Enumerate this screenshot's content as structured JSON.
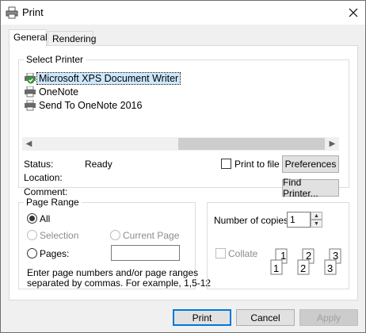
{
  "window": {
    "title": "Print",
    "close_symbol": "✕"
  },
  "tabs": [
    {
      "label": "General",
      "active": true
    },
    {
      "label": "Rendering",
      "active": false
    }
  ],
  "select_printer": {
    "group_label": "Select Printer",
    "printers": [
      {
        "name": "Microsoft XPS Document Writer",
        "selected": true,
        "icon": "printer-default-icon"
      },
      {
        "name": "OneNote",
        "selected": false,
        "icon": "printer-icon"
      },
      {
        "name": "Send To OneNote 2016",
        "selected": false,
        "icon": "printer-icon"
      }
    ],
    "status_label": "Status:",
    "status_value": "Ready",
    "location_label": "Location:",
    "comment_label": "Comment:",
    "print_to_file_label": "Print to file",
    "preferences_label": "Preferences",
    "find_printer_label": "Find Printer..."
  },
  "page_range": {
    "group_label": "Page Range",
    "all_label": "All",
    "selection_label": "Selection",
    "current_page_label": "Current Page",
    "pages_label": "Pages:",
    "pages_value": "",
    "help_line1": "Enter page numbers and/or page ranges",
    "help_line2": "separated by commas.  For example, 1,5-12",
    "selected_option": "All"
  },
  "copies": {
    "number_label": "Number of copies:",
    "number_value": "1",
    "collate_label": "Collate",
    "collate_pages": [
      "1",
      "1",
      "2",
      "2",
      "3",
      "3"
    ]
  },
  "footer": {
    "print_label": "Print",
    "cancel_label": "Cancel",
    "apply_label": "Apply"
  },
  "colors": {
    "accent": "#0078d7",
    "selected_row": "#cce8ff",
    "dialog_bg": "#f0f0f0"
  }
}
